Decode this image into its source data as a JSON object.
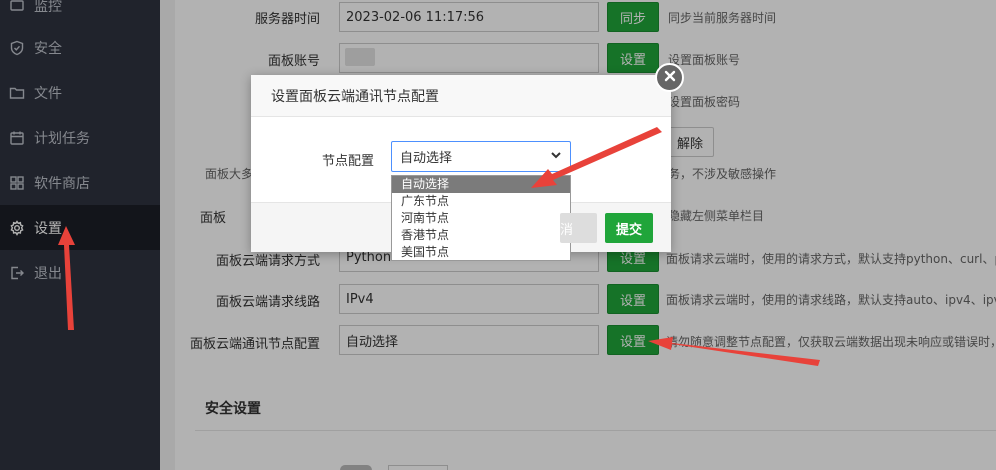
{
  "sidebar": {
    "items": [
      {
        "label": "监控",
        "icon": "monitor-icon"
      },
      {
        "label": "安全",
        "icon": "shield-icon"
      },
      {
        "label": "文件",
        "icon": "folder-icon"
      },
      {
        "label": "计划任务",
        "icon": "calendar-icon"
      },
      {
        "label": "软件商店",
        "icon": "grid-icon"
      },
      {
        "label": "设置",
        "icon": "gear-icon",
        "active": true
      },
      {
        "label": "退出",
        "icon": "logout-icon"
      }
    ]
  },
  "settings": {
    "server_time": {
      "label": "服务器时间",
      "value": "2023-02-06 11:17:56",
      "button": "同步",
      "help": "同步当前服务器时间"
    },
    "panel_account": {
      "label": "面板账号",
      "button": "设置",
      "help": "设置面板账号"
    },
    "panel_password": {
      "help": "设置面板密码"
    },
    "row3": {
      "button": "解除"
    },
    "row4": {
      "help_left": "面板大多",
      "help_right": "务，不涉及敏感操作"
    },
    "row5": {
      "label_partial": "面板",
      "help": "隐藏左侧菜单栏目"
    },
    "cloud_method": {
      "label": "面板云端请求方式",
      "value": "Python",
      "button": "设置",
      "help": "面板请求云端时，使用的请求方式，默认支持python、curl、ph"
    },
    "cloud_route": {
      "label": "面板云端请求线路",
      "value": "IPv4",
      "button": "设置",
      "help": "面板请求云端时，使用的请求线路，默认支持auto、ipv4、ipv"
    },
    "cloud_node": {
      "label": "面板云端通讯节点配置",
      "value": "自动选择",
      "button": "设置",
      "help": "请勿随意调整节点配置，仅获取云端数据出现未响应或错误时，"
    },
    "security_title": "安全设置"
  },
  "modal": {
    "title": "设置面板云端通讯节点配置",
    "field_label": "节点配置",
    "selected": "自动选择",
    "options": [
      "自动选择",
      "广东节点",
      "河南节点",
      "香港节点",
      "美国节点"
    ],
    "cancel": "取消",
    "submit": "提交"
  }
}
